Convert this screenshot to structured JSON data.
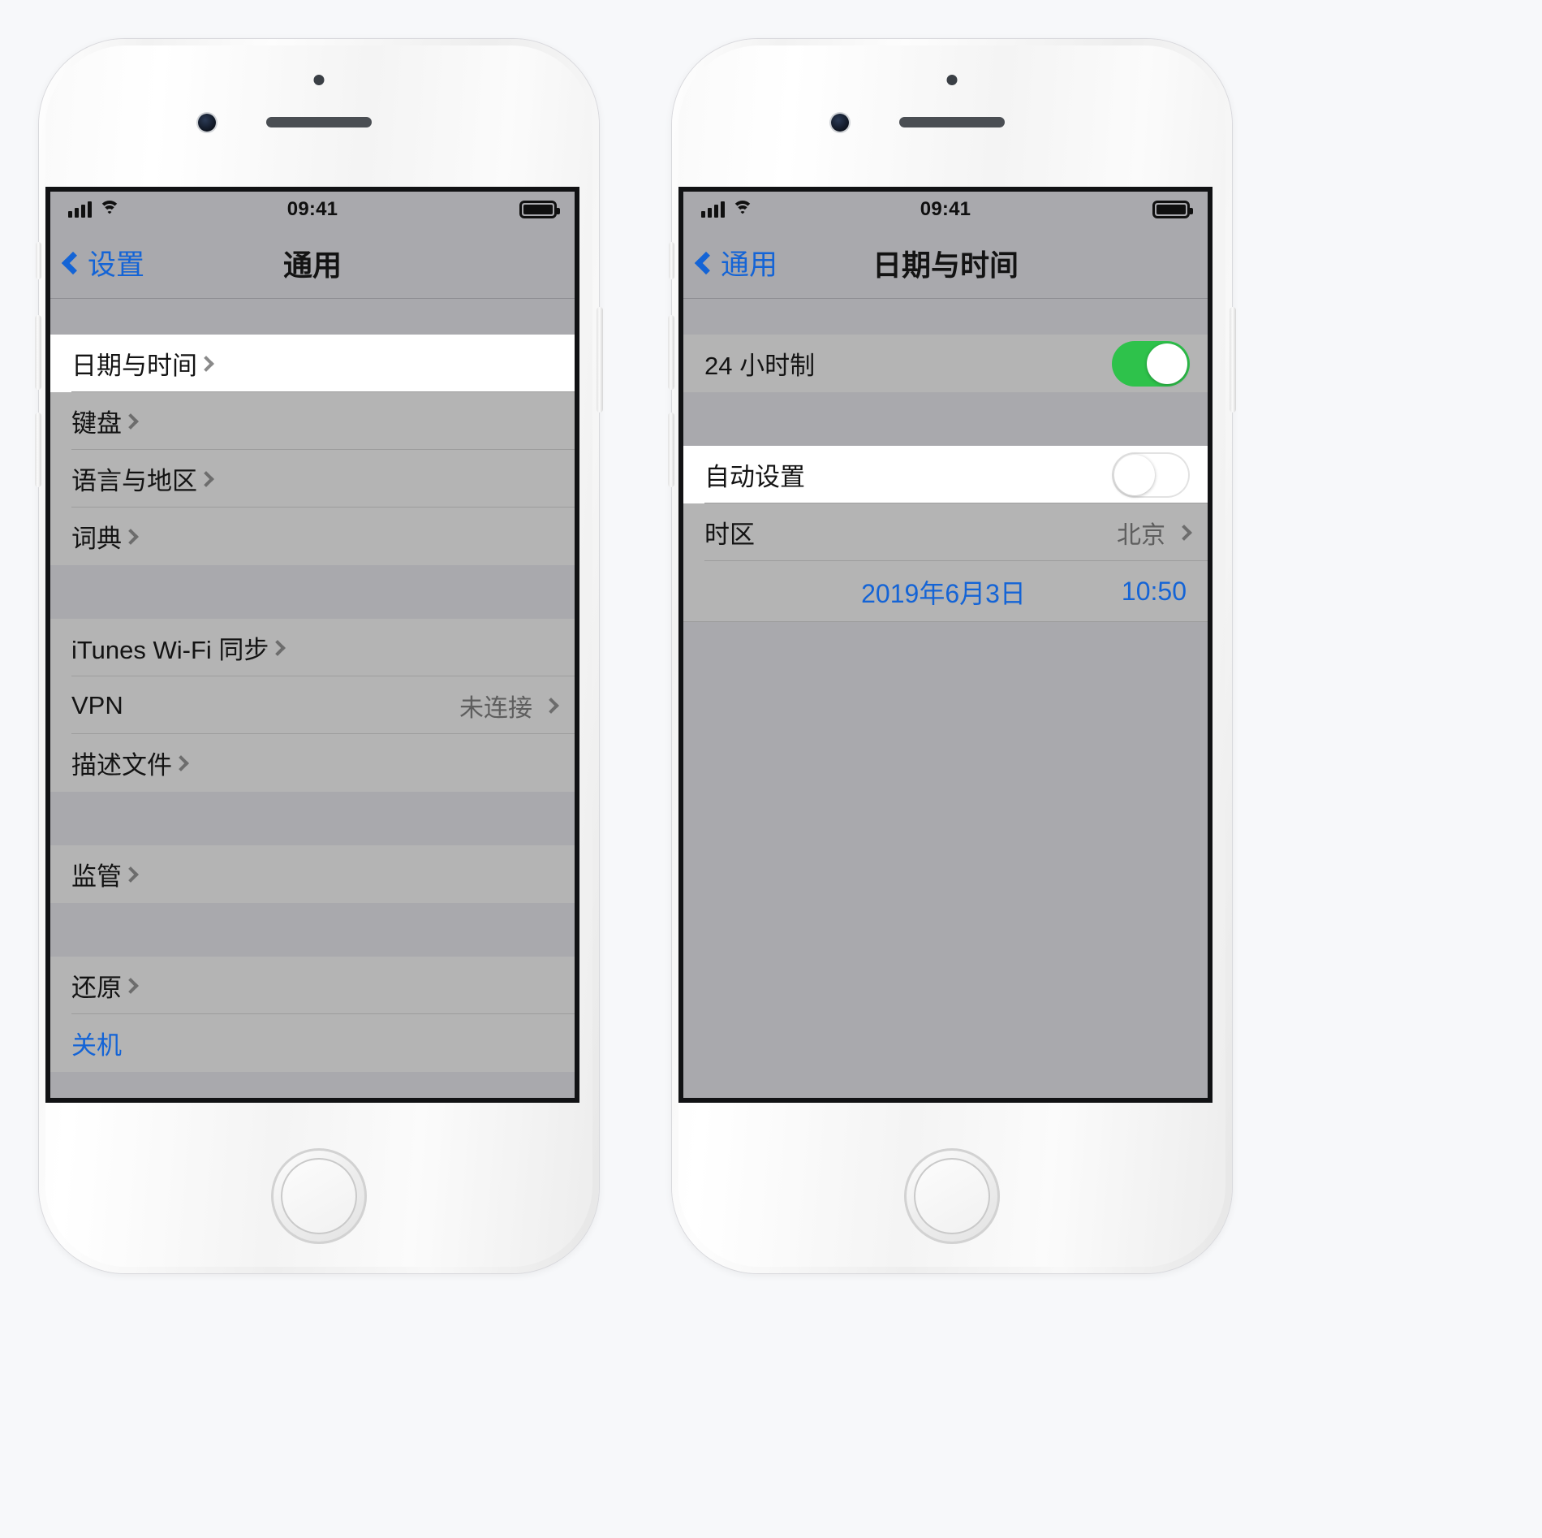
{
  "phones": [
    {
      "id": "left",
      "status_bar": {
        "time": "09:41",
        "signal_icon": "cellular-bars-icon",
        "wifi_icon": "wifi-icon",
        "battery_icon": "battery-full-icon"
      },
      "nav": {
        "back_label": "设置",
        "back_icon": "chevron-left-icon",
        "title": "通用"
      },
      "groups": [
        {
          "rows": [
            {
              "label": "日期与时间",
              "value": "",
              "accessory": "chevron",
              "highlighted": true
            }
          ]
        },
        {
          "rows": [
            {
              "label": "键盘",
              "value": "",
              "accessory": "chevron",
              "highlighted": false
            },
            {
              "label": "语言与地区",
              "value": "",
              "accessory": "chevron",
              "highlighted": false
            },
            {
              "label": "词典",
              "value": "",
              "accessory": "chevron",
              "highlighted": false
            }
          ]
        },
        {
          "rows": [
            {
              "label": "iTunes Wi-Fi 同步",
              "value": "",
              "accessory": "chevron",
              "highlighted": false
            },
            {
              "label": "VPN",
              "value": "未连接",
              "accessory": "chevron",
              "highlighted": false
            },
            {
              "label": "描述文件",
              "value": "",
              "accessory": "chevron",
              "highlighted": false
            }
          ]
        },
        {
          "rows": [
            {
              "label": "监管",
              "value": "",
              "accessory": "chevron",
              "highlighted": false
            }
          ]
        },
        {
          "rows": [
            {
              "label": "还原",
              "value": "",
              "accessory": "chevron",
              "highlighted": false
            },
            {
              "label": "关机",
              "value": "",
              "accessory": "none",
              "highlighted": false,
              "link": true
            }
          ]
        }
      ]
    },
    {
      "id": "right",
      "status_bar": {
        "time": "09:41",
        "signal_icon": "cellular-bars-icon",
        "wifi_icon": "wifi-icon",
        "battery_icon": "battery-full-icon"
      },
      "nav": {
        "back_label": "通用",
        "back_icon": "chevron-left-icon",
        "title": "日期与时间"
      },
      "groups": [
        {
          "rows": [
            {
              "label": "24 小时制",
              "value": "",
              "accessory": "switch",
              "switch_on": true,
              "highlighted": false
            }
          ]
        },
        {
          "rows": [
            {
              "label": "自动设置",
              "value": "",
              "accessory": "switch",
              "switch_on": false,
              "highlighted": true
            },
            {
              "label": "时区",
              "value": "北京",
              "accessory": "chevron",
              "highlighted": false
            }
          ]
        }
      ],
      "datetime_row": {
        "date": "2019年6月3日",
        "time": "10:50"
      }
    }
  ],
  "colors": {
    "accent_blue": "#1464d6",
    "switch_on_green": "#2ec24b",
    "row_gray": "#b4b4b4",
    "chrome_gray": "#a9a9ad",
    "row_white": "#ffffff",
    "text_primary": "#131313",
    "text_secondary": "#5e5e5e"
  }
}
